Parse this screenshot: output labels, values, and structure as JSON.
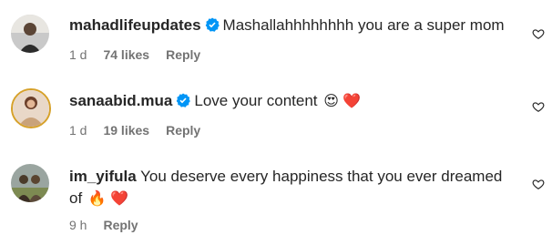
{
  "comments": [
    {
      "username": "mahadlifeupdates",
      "verified": true,
      "text": "Mashallahhhhhhhh you are a super mom",
      "time": "1 d",
      "likes": "74 likes",
      "reply": "Reply"
    },
    {
      "username": "sanaabid.mua",
      "verified": true,
      "text": "Love your content",
      "emoji": "😍 ❤️",
      "time": "1 d",
      "likes": "19 likes",
      "reply": "Reply"
    },
    {
      "username": "im_yifula",
      "verified": false,
      "text": "You deserve every happiness that you ever dreamed of",
      "emoji": "🔥 ❤️",
      "time": "9 h",
      "reply": "Reply"
    }
  ],
  "icons": {
    "verified": "verified-badge-icon",
    "like": "heart-outline-icon"
  },
  "colors": {
    "verified_blue": "#0095f6",
    "meta_gray": "#737373",
    "text": "#262626"
  }
}
